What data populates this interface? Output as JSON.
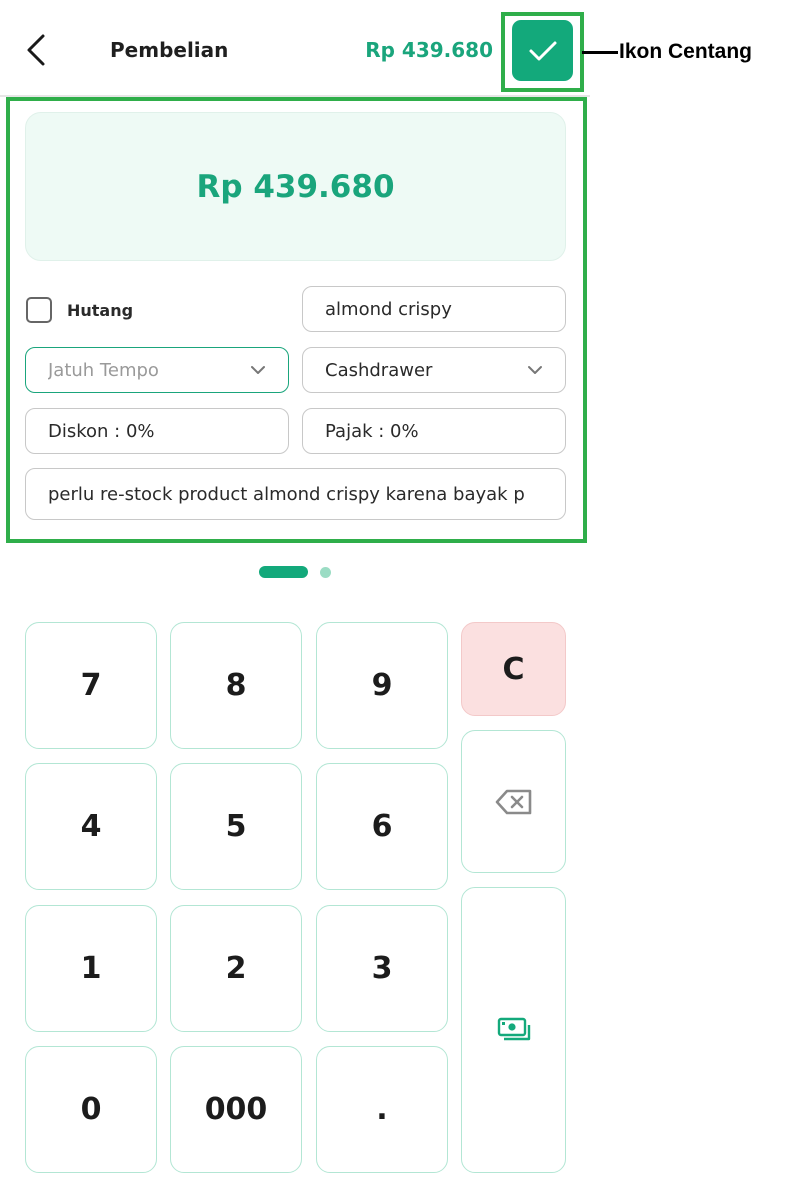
{
  "header": {
    "title": "Pembelian",
    "total": "Rp 439.680"
  },
  "annotation": {
    "label": "Ikon Centang"
  },
  "summary": {
    "amount": "Rp 439.680"
  },
  "form": {
    "debt_label": "Hutang",
    "supplier_value": "almond crispy",
    "due_date_placeholder": "Jatuh Tempo",
    "payment_source": "Cashdrawer",
    "discount": "Diskon : 0%",
    "tax": "Pajak : 0%",
    "note": "perlu re-stock product almond crispy karena bayak p"
  },
  "keypad": {
    "keys": [
      "7",
      "8",
      "9",
      "4",
      "5",
      "6",
      "1",
      "2",
      "3",
      "0",
      "000",
      "."
    ],
    "clear_label": "C"
  },
  "colors": {
    "accent": "#13a97b",
    "highlight": "#2fae4a",
    "clear_bg": "#fbe0e0"
  }
}
